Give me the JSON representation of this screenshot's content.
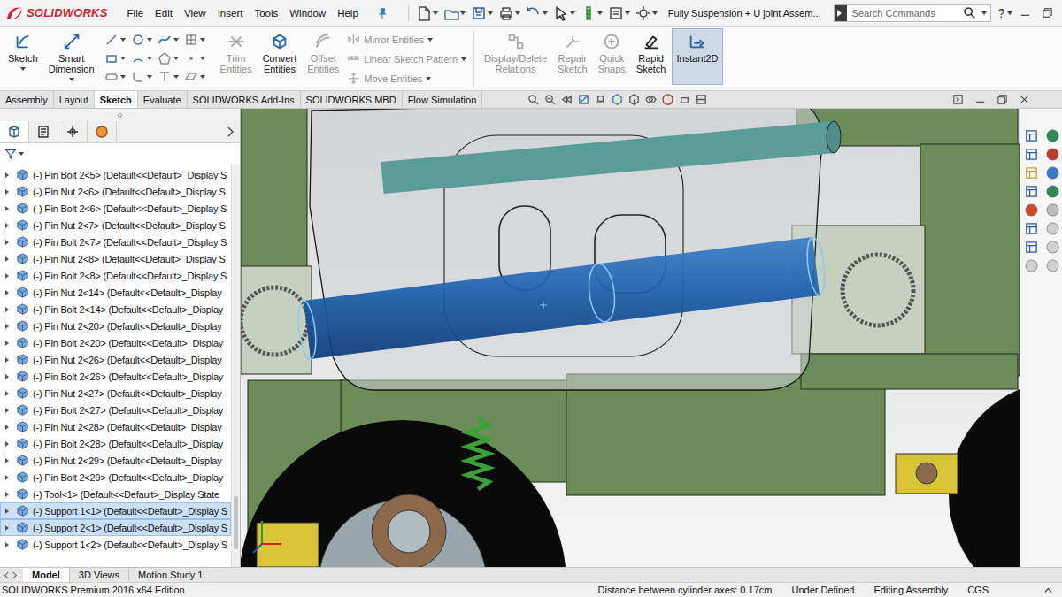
{
  "app": {
    "logo": "SOLIDWORKS"
  },
  "menu": [
    "File",
    "Edit",
    "View",
    "Insert",
    "Tools",
    "Window",
    "Help"
  ],
  "window": {
    "title": "Fully Suspension + U joint Assem..."
  },
  "search": {
    "placeholder": "Search Commands"
  },
  "help": {
    "label": "?"
  },
  "ribbon": {
    "primary": [
      {
        "label": "Sketch",
        "disabled": false,
        "selected": false
      },
      {
        "label": "Smart Dimension",
        "disabled": false,
        "selected": false
      }
    ],
    "edit": [
      {
        "label": "Trim Entities",
        "disabled": true,
        "selected": false
      },
      {
        "label": "Convert Entities",
        "disabled": false,
        "selected": false
      },
      {
        "label": "Offset Entities",
        "disabled": true,
        "selected": false
      }
    ],
    "stack": [
      {
        "label": "Mirror Entities",
        "disabled": true,
        "selected": false
      },
      {
        "label": "Linear Sketch Pattern",
        "disabled": true,
        "selected": false
      },
      {
        "label": "Move Entities",
        "disabled": true,
        "selected": false
      }
    ],
    "tools": [
      {
        "label": "Display/Delete Relations",
        "disabled": true,
        "selected": false
      },
      {
        "label": "Repair Sketch",
        "disabled": true,
        "selected": false
      },
      {
        "label": "Quick Snaps",
        "disabled": true,
        "selected": false
      },
      {
        "label": "Rapid Sketch",
        "disabled": false,
        "selected": false
      },
      {
        "label": "Instant2D",
        "disabled": false,
        "selected": true
      }
    ]
  },
  "tabs": [
    {
      "label": "Assembly",
      "selected": false
    },
    {
      "label": "Layout",
      "selected": false
    },
    {
      "label": "Sketch",
      "selected": true
    },
    {
      "label": "Evaluate",
      "selected": false
    },
    {
      "label": "SOLIDWORKS Add-Ins",
      "selected": false
    },
    {
      "label": "SOLIDWORKS MBD",
      "selected": false
    },
    {
      "label": "Flow Simulation",
      "selected": false
    }
  ],
  "tree": {
    "items": [
      {
        "label": "(-) Pin Bolt 2<5> (Default<<Default>_Display S",
        "selected": false
      },
      {
        "label": "(-) Pin Nut 2<6> (Default<<Default>_Display S",
        "selected": false
      },
      {
        "label": "(-) Pin Bolt 2<6> (Default<<Default>_Display S",
        "selected": false
      },
      {
        "label": "(-) Pin Nut 2<7> (Default<<Default>_Display S",
        "selected": false
      },
      {
        "label": "(-) Pin Bolt 2<7> (Default<<Default>_Display S",
        "selected": false
      },
      {
        "label": "(-) Pin Nut 2<8> (Default<<Default>_Display S",
        "selected": false
      },
      {
        "label": "(-) Pin Bolt 2<8> (Default<<Default>_Display S",
        "selected": false
      },
      {
        "label": "(-) Pin Nut 2<14> (Default<<Default>_Display",
        "selected": false
      },
      {
        "label": "(-) Pin Bolt 2<14> (Default<<Default>_Display",
        "selected": false
      },
      {
        "label": "(-) Pin Nut 2<20> (Default<<Default>_Display",
        "selected": false
      },
      {
        "label": "(-) Pin Bolt 2<20> (Default<<Default>_Display",
        "selected": false
      },
      {
        "label": "(-) Pin Nut 2<26> (Default<<Default>_Display",
        "selected": false
      },
      {
        "label": "(-) Pin Bolt 2<26> (Default<<Default>_Display",
        "selected": false
      },
      {
        "label": "(-) Pin Nut 2<27> (Default<<Default>_Display",
        "selected": false
      },
      {
        "label": "(-) Pin Bolt 2<27> (Default<<Default>_Display",
        "selected": false
      },
      {
        "label": "(-) Pin Nut 2<28> (Default<<Default>_Display",
        "selected": false
      },
      {
        "label": "(-) Pin Bolt 2<28> (Default<<Default>_Display",
        "selected": false
      },
      {
        "label": "(-) Pin Nut 2<29> (Default<<Default>_Display",
        "selected": false
      },
      {
        "label": "(-) Pin Bolt 2<29> (Default<<Default>_Display",
        "selected": false
      },
      {
        "label": "(-) Tool<1> (Default<<Default>_Display State",
        "selected": false
      },
      {
        "label": "(-) Support 1<1> (Default<<Default>_Display S",
        "selected": true
      },
      {
        "label": "(-) Support 2<1> (Default<<Default>_Display S",
        "selected": true
      },
      {
        "label": "(-) Support 1<2> (Default<<Default>_Display S",
        "selected": false
      }
    ]
  },
  "bottom_tabs": [
    {
      "label": "Model",
      "selected": true
    },
    {
      "label": "3D Views",
      "selected": false
    },
    {
      "label": "Motion Study 1",
      "selected": false
    }
  ],
  "status_bar": {
    "edition": "SOLIDWORKS Premium 2016 x64 Edition",
    "message": "Distance between cylinder axes: 0.17cm",
    "state": "Under Defined",
    "mode": "Editing Assembly",
    "units": "CGS"
  }
}
